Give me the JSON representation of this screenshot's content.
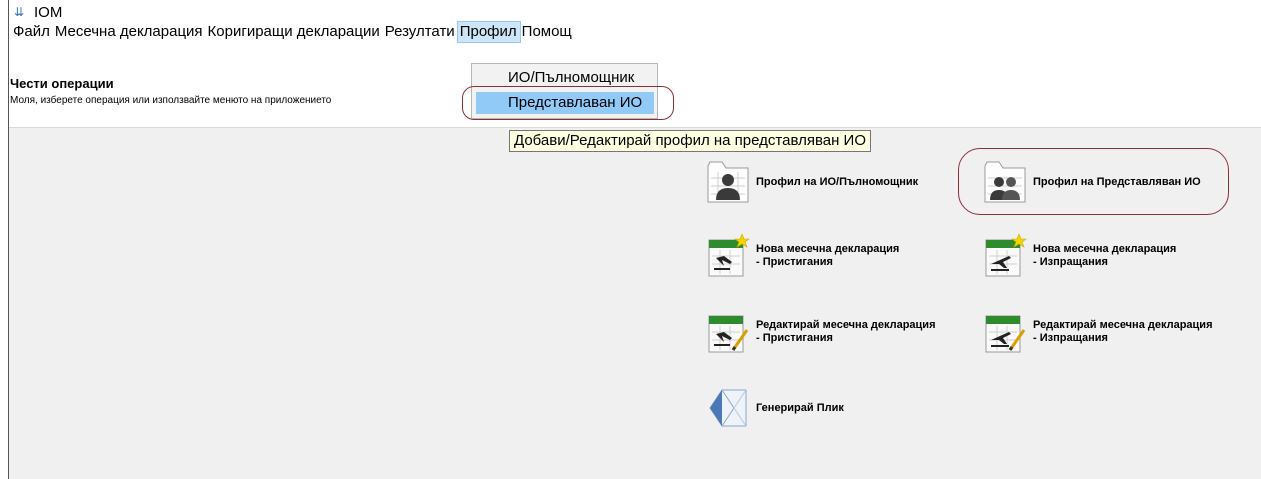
{
  "app": {
    "title": "IOM",
    "icon": "chevron-double-down-icon"
  },
  "menu": [
    "Файл",
    "Месечна декларация",
    "Коригиращи декларации",
    "Резултати",
    "Профил",
    "Помощ"
  ],
  "header": {
    "title": "Чести операции",
    "subtitle": "Моля, изберете операция или използвайте менюто на приложението"
  },
  "dropdown": {
    "items": [
      "ИО/Пълномощник",
      "Представлаван ИО"
    ],
    "selected": "Представлаван ИО"
  },
  "tooltip": "Добави/Редактирай профил на представляван ИО",
  "tiles": [
    {
      "line1": "Профил на ИО/Пълномощник",
      "line2": "",
      "icon": "profile-single-icon"
    },
    {
      "line1": "Профил на Представляван ИО",
      "line2": "",
      "icon": "profile-group-icon"
    },
    {
      "line1": "Нова месечна декларация",
      "line2": "- Пристигания",
      "icon": "new-arrivals-declaration-icon"
    },
    {
      "line1": "Нова месечна декларация",
      "line2": "- Изпращания",
      "icon": "new-dispatches-declaration-icon"
    },
    {
      "line1": "Редактирай месечна декларация",
      "line2": "- Пристигания",
      "icon": "edit-arrivals-declaration-icon"
    },
    {
      "line1": "Редактирай месечна декларация",
      "line2": "- Изпращания",
      "icon": "edit-dispatches-declaration-icon"
    },
    {
      "line1": "Генерирай Плик",
      "line2": "",
      "icon": "generate-envelope-icon"
    }
  ],
  "colors": {
    "highlight": "#8b2f3a",
    "selection": "#91c9f7",
    "tooltip": "#ffffe1",
    "panel": "#f0f0f0"
  }
}
